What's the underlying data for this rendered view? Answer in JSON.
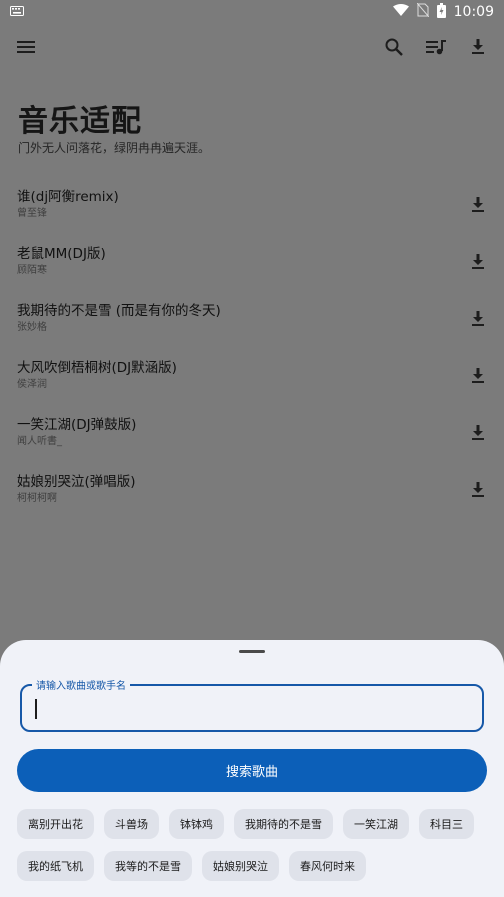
{
  "status_bar": {
    "time": "10:09",
    "icons": [
      "keyboard-icon",
      "wifi-icon",
      "no-sim-icon",
      "battery-icon"
    ]
  },
  "app_bar": {
    "icons": [
      "menu-icon",
      "search-icon",
      "playlist-icon",
      "download-icon"
    ]
  },
  "header": {
    "title": "音乐适配",
    "subtitle": "门外无人问落花，绿阴冉冉遍天涯。"
  },
  "songs": [
    {
      "name": "谁(dj阿衡remix)",
      "artist": "曾至锋"
    },
    {
      "name": "老鼠MM(DJ版)",
      "artist": "顾陌寒"
    },
    {
      "name": "我期待的不是雪 (而是有你的冬天)",
      "artist": "张妙格"
    },
    {
      "name": "大风吹倒梧桐树(DJ默涵版)",
      "artist": "侯泽润"
    },
    {
      "name": "一笑江湖(DJ弹鼓版)",
      "artist": "闻人听書_"
    },
    {
      "name": "姑娘别哭泣(弹唱版)",
      "artist": "柯柯柯啊"
    }
  ],
  "search_sheet": {
    "input_label": "请输入歌曲或歌手名",
    "input_value": "",
    "search_button": "搜索歌曲",
    "chips": [
      "离别开出花",
      "斗兽场",
      "钵钵鸡",
      "我期待的不是雪",
      "一笑江湖",
      "科目三",
      "我的纸飞机",
      "我等的不是雪",
      "姑娘别哭泣",
      "春风何时来"
    ]
  },
  "colors": {
    "scrim": "#7b7b7b",
    "sheet_bg": "#f0f2f8",
    "accent": "#0c5fb8",
    "chip_bg": "#dfe2ea"
  }
}
